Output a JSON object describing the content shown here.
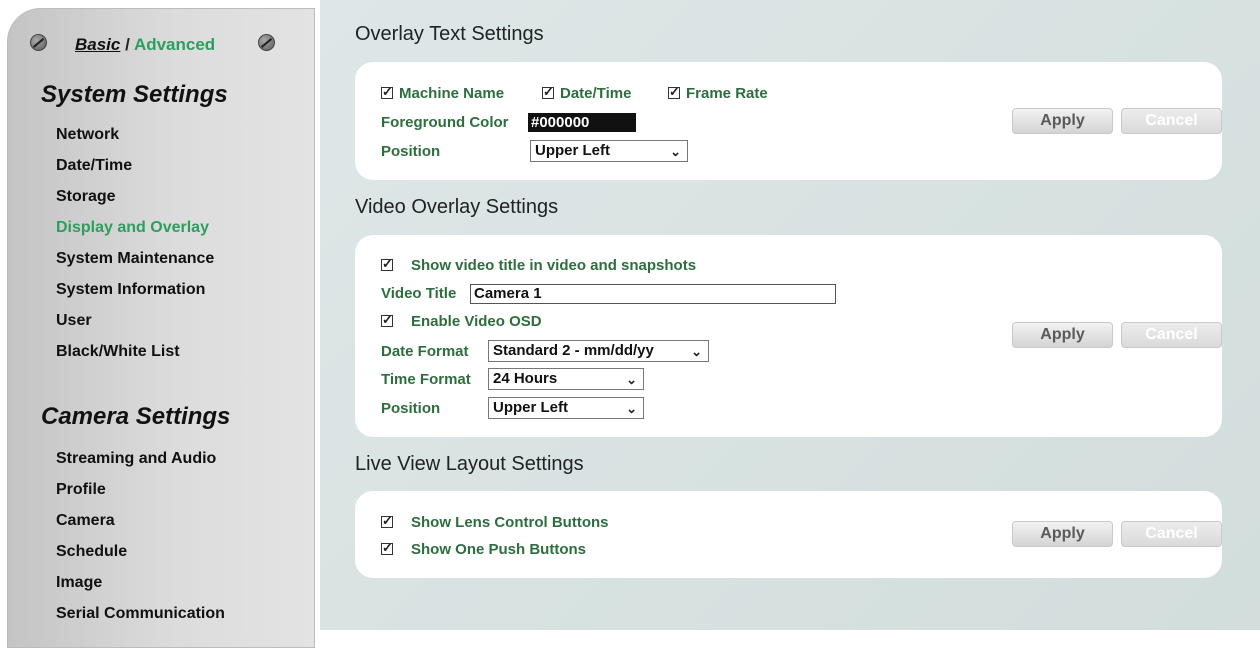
{
  "sidebar": {
    "mode": {
      "basic": "Basic",
      "separator": "/",
      "advanced": "Advanced"
    },
    "system_title": "System Settings",
    "system_items": [
      {
        "label": "Network"
      },
      {
        "label": "Date/Time"
      },
      {
        "label": "Storage"
      },
      {
        "label": "Display and Overlay",
        "active": true
      },
      {
        "label": "System Maintenance"
      },
      {
        "label": "System Information"
      },
      {
        "label": "User"
      },
      {
        "label": "Black/White List"
      }
    ],
    "camera_title": "Camera Settings",
    "camera_items": [
      {
        "label": "Streaming and Audio"
      },
      {
        "label": "Profile"
      },
      {
        "label": "Camera"
      },
      {
        "label": "Schedule"
      },
      {
        "label": "Image"
      },
      {
        "label": "Serial Communication"
      }
    ]
  },
  "overlay_text": {
    "heading": "Overlay Text Settings",
    "machine_name": {
      "label": "Machine Name",
      "checked": true
    },
    "date_time": {
      "label": "Date/Time",
      "checked": true
    },
    "frame_rate": {
      "label": "Frame Rate",
      "checked": true
    },
    "fg_color_label": "Foreground Color",
    "fg_color_value": "#000000",
    "position_label": "Position",
    "position_value": "Upper Left",
    "apply": "Apply",
    "cancel": "Cancel"
  },
  "video_overlay": {
    "heading": "Video Overlay Settings",
    "show_title": {
      "label": "Show video title in video and snapshots",
      "checked": true
    },
    "title_label": "Video Title",
    "title_value": "Camera 1",
    "enable_osd": {
      "label": "Enable Video OSD",
      "checked": true
    },
    "date_format_label": "Date Format",
    "date_format_value": "Standard 2 - mm/dd/yy",
    "time_format_label": "Time Format",
    "time_format_value": "24 Hours",
    "position_label": "Position",
    "position_value": "Upper Left",
    "apply": "Apply",
    "cancel": "Cancel"
  },
  "live_view": {
    "heading": "Live View Layout Settings",
    "lens_buttons": {
      "label": "Show Lens Control Buttons",
      "checked": true
    },
    "one_push": {
      "label": "Show One Push Buttons",
      "checked": true
    },
    "apply": "Apply",
    "cancel": "Cancel"
  },
  "colors": {
    "accent_green": "#2e9e5e",
    "label_green": "#2e6e3e",
    "main_bg": "#d9e4e3"
  }
}
